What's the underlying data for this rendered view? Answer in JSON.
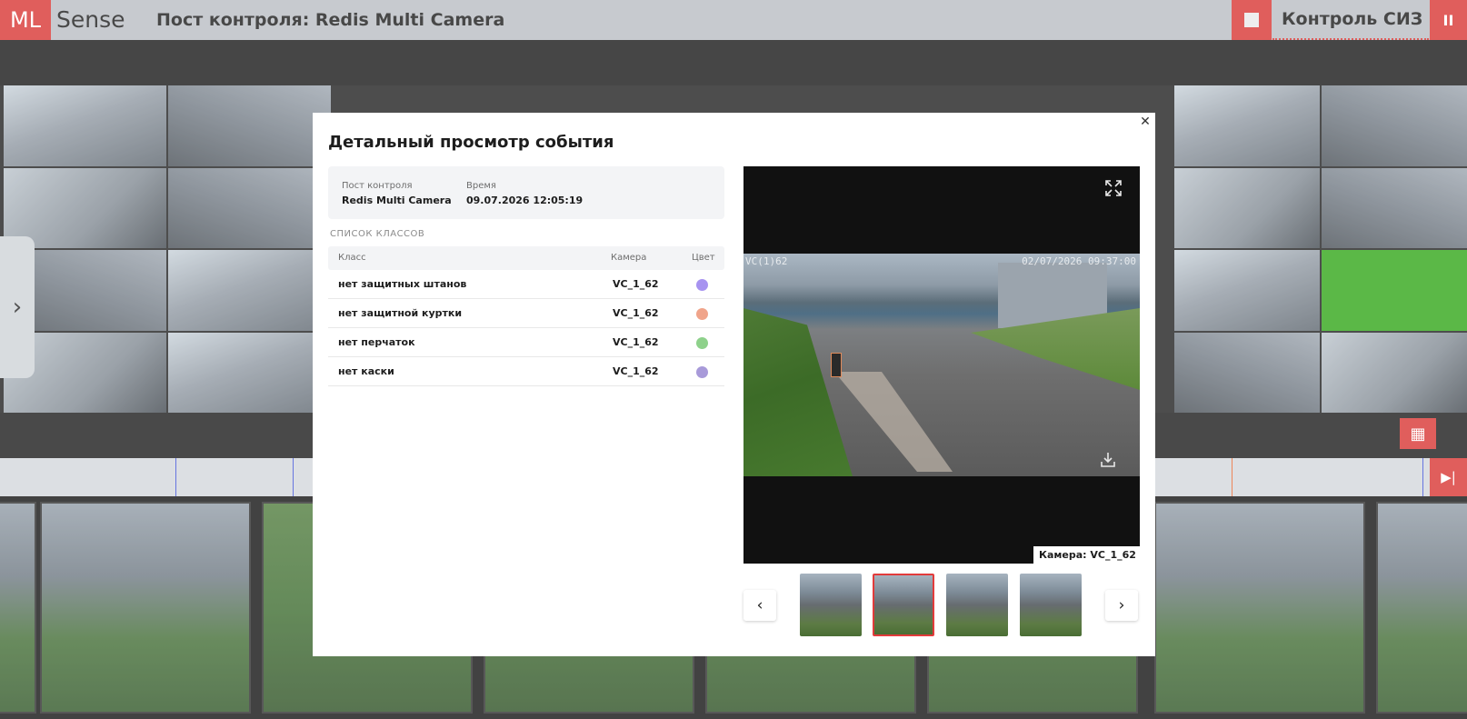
{
  "header": {
    "logo_ml": "ML",
    "logo_sense": "Sense",
    "post_title": "Пост контроля: Redis Multi Camera",
    "mode_title": "Контроль СИЗ",
    "pause_symbol": "II"
  },
  "colors": {
    "brand_red": "#d8312f",
    "selected_thumb_border": "#e23b3b"
  },
  "icons": {
    "stop": "stop-icon",
    "pause": "pause-icon",
    "grid": "grid-icon",
    "expand": "expand-icon",
    "download": "download-icon",
    "close": "close-icon",
    "prev": "chevron-left-icon",
    "next": "chevron-right-icon"
  },
  "modal": {
    "title": "Детальный просмотр события",
    "post_label": "Пост контроля",
    "post_value": "Redis Multi Camera",
    "time_label": "Время",
    "time_value": "09.07.2026 12:05:19",
    "section_label": "СПИСОК КЛАССОВ",
    "table": {
      "headers": [
        "Класс",
        "Камера",
        "Цвет"
      ],
      "rows": [
        {
          "class": "нет защитных штанов",
          "camera": "VC_1_62",
          "color": "#a793f0"
        },
        {
          "class": "нет защитной куртки",
          "camera": "VC_1_62",
          "color": "#f0a48a"
        },
        {
          "class": "нет перчаток",
          "camera": "VC_1_62",
          "color": "#8ed18b"
        },
        {
          "class": "нет каски",
          "camera": "VC_1_62",
          "color": "#a89ad9"
        }
      ]
    },
    "viewer": {
      "overlay_left": "VC(1)62",
      "overlay_right": "02/07/2026 09:37:00",
      "camera_label": "Камера: VC_1_62",
      "thumbnails_count": 4,
      "selected_thumbnail": 2
    }
  }
}
